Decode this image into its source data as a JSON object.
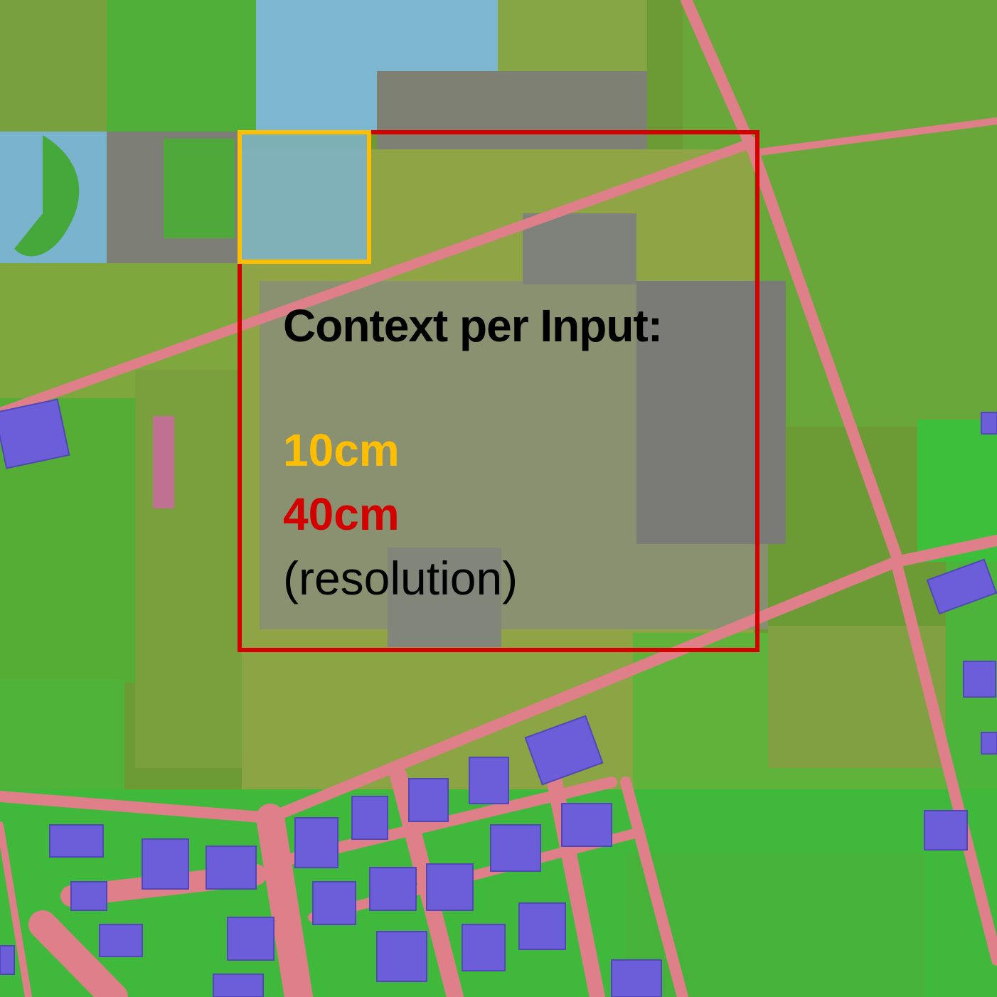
{
  "annotation": {
    "heading": "Context per Input:",
    "small_context_label": "10cm",
    "large_context_label": "40cm",
    "note": "(resolution)"
  },
  "colors": {
    "small_context": "#ffbf00",
    "large_context": "#d40000",
    "road_class": "#e07a86",
    "building_class": "#6a5ce0",
    "vegetation_class": "#3fbf3a",
    "field_class": "#8faa3a",
    "bare_class": "#7f7f78",
    "water_class": "#79b6d8"
  }
}
